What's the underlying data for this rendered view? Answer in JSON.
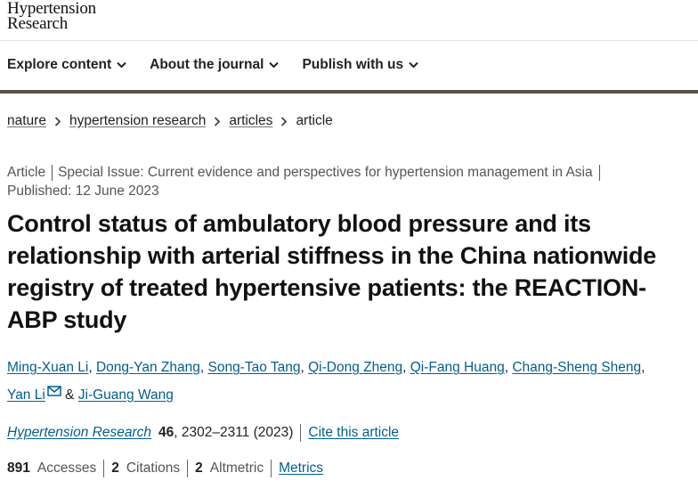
{
  "logo": {
    "line1": "Hypertension",
    "line2": "Research"
  },
  "nav": [
    {
      "label": "Explore content"
    },
    {
      "label": "About the journal"
    },
    {
      "label": "Publish with us"
    }
  ],
  "breadcrumb": [
    "nature",
    "hypertension research",
    "articles",
    "article"
  ],
  "article": {
    "type": "Article",
    "special_issue": "Special Issue: Current evidence and perspectives for hypertension management in Asia",
    "published": "Published: 12 June 2023",
    "title": "Control status of ambulatory blood pressure and its relationship with arterial stiffness in the China nationwide registry of treated hypertensive patients: the REACTION-ABP study",
    "authors": [
      "Ming-Xuan Li",
      "Dong-Yan Zhang",
      "Song-Tao Tang",
      "Qi-Dong Zheng",
      "Qi-Fang Huang",
      "Chang-Sheng Sheng",
      "Yan Li",
      "Ji-Guang Wang"
    ],
    "author_sep": ", ",
    "author_and": " & ",
    "journal": "Hypertension Research",
    "volume": "46",
    "pages_year": ", 2302–2311 (2023)",
    "cite_label": "Cite this article"
  },
  "metrics": {
    "accesses_count": "891",
    "accesses_label": "Accesses",
    "citations_count": "2",
    "citations_label": "Citations",
    "altmetric_count": "2",
    "altmetric_label": "Altmetric",
    "metrics_link": "Metrics"
  },
  "colors": {
    "link": "#025e8d",
    "nav_rule": "#5a4e48",
    "text": "#222222",
    "muted": "#555555"
  },
  "icons": {
    "nav_dropdown": "chevron-down-icon",
    "breadcrumb_sep": "chevron-right-icon",
    "corresponding": "envelope-icon"
  }
}
